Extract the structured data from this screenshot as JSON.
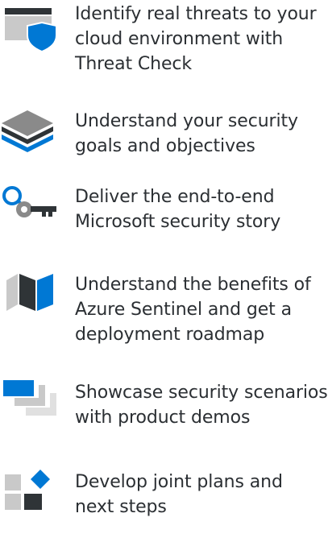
{
  "items": [
    {
      "icon": "shield-window-icon",
      "text": "Identify real threats to your\ncloud environment with\nThreat Check"
    },
    {
      "icon": "layers-icon",
      "text": "Understand your security\ngoals and objectives"
    },
    {
      "icon": "search-key-icon",
      "text": "Deliver the end-to-end\nMicrosoft security story"
    },
    {
      "icon": "map-icon",
      "text": "Understand the benefits of\nAzure Sentinel and get a\ndeployment roadmap"
    },
    {
      "icon": "stacked-windows-icon",
      "text": "Showcase security scenarios\nwith product demos"
    },
    {
      "icon": "blocks-diamond-icon",
      "text": "Develop joint plans and\nnext steps"
    }
  ],
  "colors": {
    "blue": "#0078D4",
    "dark_blue": "#1F3A5F",
    "dark": "#2F3437",
    "gray": "#8A8A8A",
    "light_gray": "#C9C9C9"
  }
}
